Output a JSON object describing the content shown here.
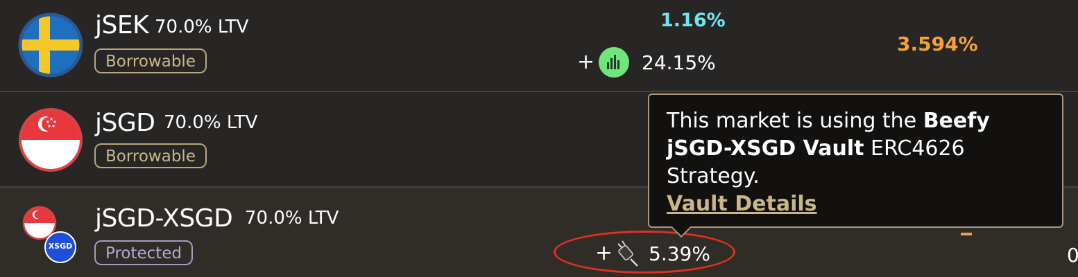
{
  "rows": [
    {
      "name": "jSEK",
      "ltv": "70.0% LTV",
      "badge": "Borrowable",
      "supply_apy": "1.16%",
      "reward_plus": "+",
      "reward_apy": "24.15%",
      "borrow_apy": "3.594%"
    },
    {
      "name": "jSGD",
      "ltv": "70.0% LTV",
      "badge": "Borrowable"
    },
    {
      "name": "jSGD-XSGD",
      "ltv": "70.0% LTV",
      "badge": "Protected",
      "reward_plus": "+",
      "reward_apy": "5.39%",
      "token_badge_label": "XSGD",
      "edge_value": "0"
    }
  ],
  "tooltip": {
    "text_prefix": "This market is using the ",
    "text_bold": "Beefy jSGD-XSGD Vault",
    "text_suffix": " ERC4626 Strategy.",
    "link": "Vault Details"
  },
  "colors": {
    "cyan_apy": "#6fe6f0",
    "orange_apy": "#f3a239",
    "borrowable_badge": "#c9b78a",
    "protected_badge": "#b7a8d4",
    "highlight_ellipse": "#e0311f"
  },
  "icons": [
    "sweden-flag-icon",
    "singapore-flag-icon",
    "xsgd-token-icon",
    "beefy-rewards-icon",
    "plugin-icon"
  ]
}
